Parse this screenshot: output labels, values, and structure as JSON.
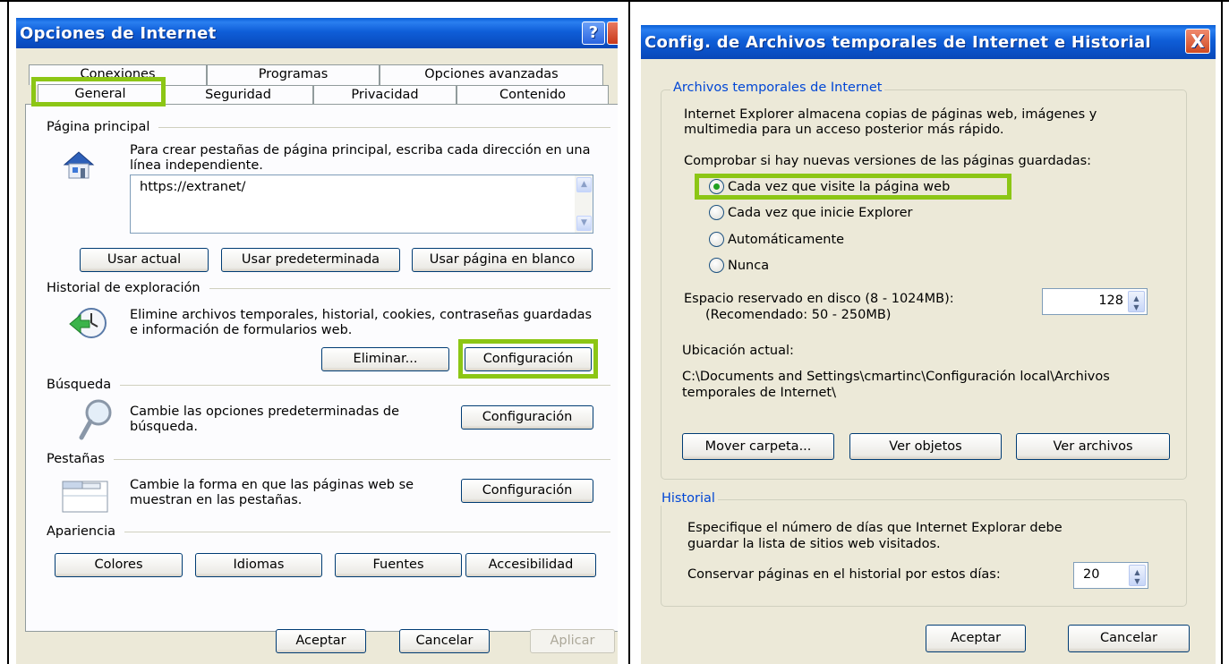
{
  "left_dialog": {
    "title": "Opciones de Internet",
    "help_label": "?",
    "tabs_back": [
      "Conexiones",
      "Programas",
      "Opciones avanzadas"
    ],
    "tabs_front": [
      "General",
      "Seguridad",
      "Privacidad",
      "Contenido"
    ],
    "selected_tab": "General",
    "home_page": {
      "header": "Página principal",
      "description": "Para crear pestañas de página principal, escriba cada dirección en una línea independiente.",
      "url": "https://extranet/",
      "btn_current": "Usar actual",
      "btn_default": "Usar predeterminada",
      "btn_blank": "Usar página en blanco"
    },
    "history": {
      "header": "Historial de exploración",
      "description": "Elimine archivos temporales, historial, cookies, contraseñas guardadas e información de formularios web.",
      "btn_delete": "Eliminar...",
      "btn_settings": "Configuración"
    },
    "search": {
      "header": "Búsqueda",
      "description": "Cambie las opciones predeterminadas de búsqueda.",
      "btn_settings": "Configuración"
    },
    "tabs_section": {
      "header": "Pestañas",
      "description": "Cambie la forma en que las páginas web se muestran en las pestañas.",
      "btn_settings": "Configuración"
    },
    "appearance": {
      "header": "Apariencia",
      "btn_colors": "Colores",
      "btn_languages": "Idiomas",
      "btn_fonts": "Fuentes",
      "btn_accessibility": "Accesibilidad"
    },
    "footer": {
      "ok": "Aceptar",
      "cancel": "Cancelar",
      "apply": "Aplicar"
    }
  },
  "right_dialog": {
    "title": "Config. de Archivos temporales de Internet e Historial",
    "close_label": "X",
    "temp_files": {
      "legend": "Archivos temporales de Internet",
      "description": "Internet Explorer almacena copias de páginas web, imágenes y multimedia para un acceso posterior más rápido.",
      "check_label": "Comprobar si hay nuevas versiones de las páginas guardadas:",
      "options": [
        {
          "label": "Cada vez que visite la página web",
          "checked": true
        },
        {
          "label": "Cada vez que inicie Explorer",
          "checked": false
        },
        {
          "label": "Automáticamente",
          "checked": false
        },
        {
          "label": "Nunca",
          "checked": false
        }
      ],
      "disk_label_1": "Espacio reservado en disco (8 - 1024MB):",
      "disk_label_2": "(Recomendado: 50 - 250MB)",
      "disk_value": "128",
      "location_label": "Ubicación actual:",
      "location_path_1": "C:\\Documents and Settings\\cmartinc\\Configuración local\\Archivos",
      "location_path_2": "temporales de Internet\\",
      "btn_move": "Mover carpeta...",
      "btn_objects": "Ver objetos",
      "btn_files": "Ver archivos"
    },
    "history": {
      "legend": "Historial",
      "description_1": "Especifique el número de días que Internet Explorar debe",
      "description_2": "guardar la lista de sitios web visitados.",
      "days_label": "Conservar páginas en el historial por estos días:",
      "days_value": "20"
    },
    "footer": {
      "ok": "Aceptar",
      "cancel": "Cancelar"
    }
  },
  "colors": {
    "highlight": "#8cc615",
    "titlebar": "#0a4fc4",
    "dialog_bg": "#ece9d8",
    "legend_blue": "#0046d5"
  }
}
